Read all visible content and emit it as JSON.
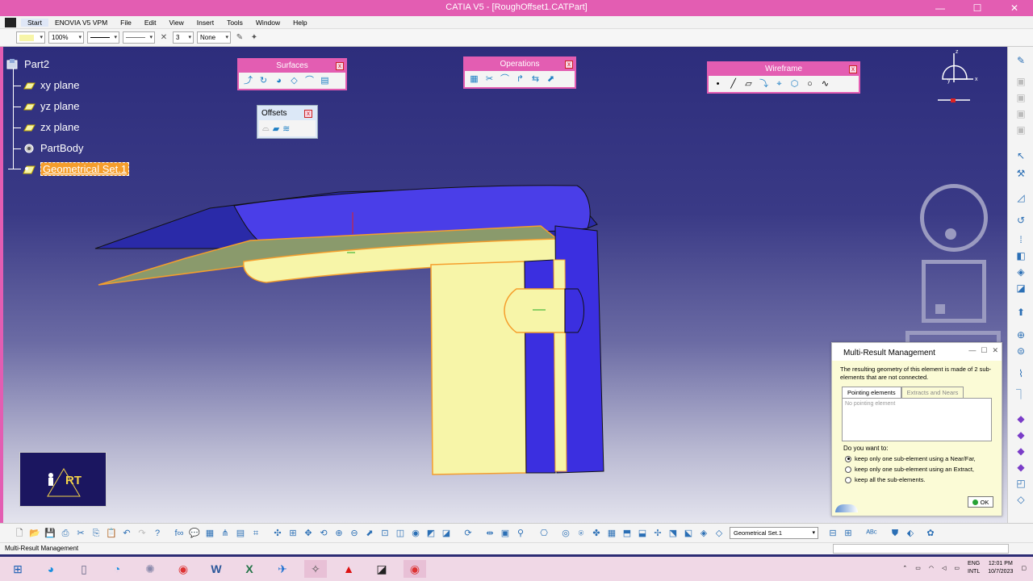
{
  "window": {
    "title": "CATIA V5 - [RoughOffset1.CATPart]"
  },
  "menu": [
    "Start",
    "ENOVIA V5 VPM",
    "File",
    "Edit",
    "View",
    "Insert",
    "Tools",
    "Window",
    "Help"
  ],
  "properties": {
    "zoom": "100%",
    "thickness": "3",
    "layer": "None"
  },
  "tree": {
    "root": "Part2",
    "items": [
      "xy plane",
      "yz plane",
      "zx plane",
      "PartBody",
      "Geometrical Set.1"
    ]
  },
  "toolbars": {
    "surfaces": "Surfaces",
    "offsets": "Offsets",
    "operations": "Operations",
    "wireframe": "Wireframe"
  },
  "compass": {
    "x": "x",
    "y": "y",
    "z": "z"
  },
  "logo": {
    "text": "RT"
  },
  "dialog": {
    "title": "Multi-Result  Management",
    "message": "The resulting geometry of this element is made of 2 sub-elements that are not connected.",
    "tab_active": "Pointing elements",
    "tab_inactive": "Extracts and Nears",
    "list_placeholder": "No pointing element",
    "question": "Do you want to:",
    "options": [
      "keep  only  one  sub-element using a Near/Far,",
      "keep  only  one  sub-element using an Extract,",
      "keep all the sub-elements."
    ],
    "ok": "OK"
  },
  "bottom": {
    "current_set": "Geometrical Set.1"
  },
  "status": {
    "text": "Multi-Result  Management"
  },
  "taskbar": {
    "lang1": "ENG",
    "lang2": "INTL",
    "time": "12:01 PM",
    "date": "10/7/2023"
  },
  "colors": {
    "accent": "#e35db2",
    "surface_yellow": "#f7f5a8",
    "surface_blue": "#3b2fe0",
    "highlight_orange": "#f59e2c"
  }
}
